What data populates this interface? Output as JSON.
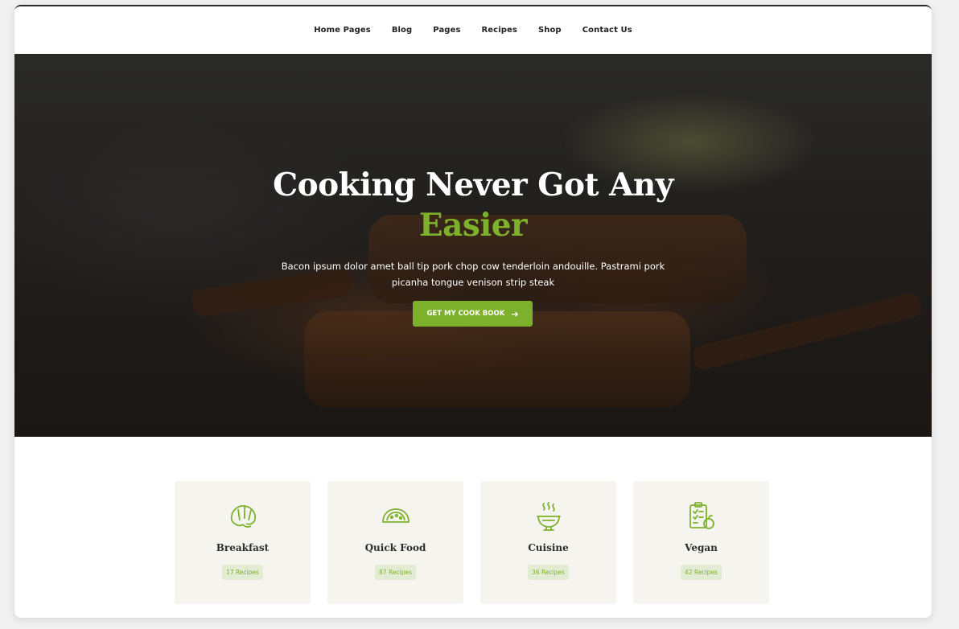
{
  "nav": {
    "items": [
      "Home Pages",
      "Blog",
      "Pages",
      "Recipes",
      "Shop",
      "Contact Us"
    ]
  },
  "hero": {
    "title_line1": "Cooking Never Got Any",
    "title_line2": "Easier",
    "subtitle": "Bacon ipsum dolor amet ball tip pork chop cow tenderloin andouille. Pastrami pork picanha tongue venison strip steak",
    "button_label": "GET MY COOK BOOK",
    "button_icon": "arrow-right-icon"
  },
  "categories": [
    {
      "name": "Breakfast",
      "count": "17 Recipes",
      "icon": "croissant-icon"
    },
    {
      "name": "Quick Food",
      "count": "87 Recipes",
      "icon": "taco-icon"
    },
    {
      "name": "Cuisine",
      "count": "36 Recipes",
      "icon": "steaming-bowl-icon"
    },
    {
      "name": "Vegan",
      "count": "42 Recipes",
      "icon": "clipboard-apple-icon"
    }
  ],
  "colors": {
    "accent": "#7db12c",
    "card_bg": "#f6f4ef",
    "badge_bg": "#e2ecd2"
  }
}
